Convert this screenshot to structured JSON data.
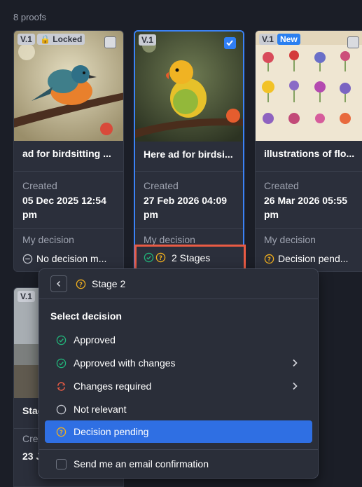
{
  "proof_count": "8 proofs",
  "colors": {
    "accent": "#2f6fe3",
    "approved": "#22b47a",
    "pending": "#f2b01e",
    "changes": "#ea5b44",
    "highlight": "#ea5b44"
  },
  "cards": [
    {
      "version": "V.1",
      "locked_label": "Locked",
      "checked": false,
      "title": "ad for birdsitting ...",
      "created_label": "Created",
      "created": "05 Dec 2025 12:54 pm",
      "decision_label": "My decision",
      "decision": "No decision m...",
      "decision_icon": "no-decision-icon"
    },
    {
      "version": "V.1",
      "checked": true,
      "title": "Here ad for birdsi...",
      "created_label": "Created",
      "created": "27 Feb 2026 04:09 pm",
      "decision_label": "My decision",
      "decision": "2 Stages",
      "decision_icon": "approved-pending-icons"
    },
    {
      "version": "V.1",
      "new_label": "New",
      "checked": false,
      "title": "illustrations of flo...",
      "created_label": "Created",
      "created": "26 Mar 2026 05:55 pm",
      "decision_label": "My decision",
      "decision": "Decision pend...",
      "decision_icon": "pending-icon"
    },
    {
      "version": "V.1",
      "title_partial": "Stag",
      "created_partial": "Cre",
      "date_partial": "23 J"
    }
  ],
  "popover": {
    "stage_title": "Stage 2",
    "back_icon": "chevron-left-icon",
    "section_title": "Select decision",
    "options": [
      {
        "label": "Approved",
        "icon": "check-circle-icon",
        "has_submenu": false,
        "active": false
      },
      {
        "label": "Approved with changes",
        "icon": "check-circle-icon",
        "has_submenu": true,
        "active": false
      },
      {
        "label": "Changes required",
        "icon": "changes-icon",
        "has_submenu": true,
        "active": false
      },
      {
        "label": "Not relevant",
        "icon": "empty-circle-icon",
        "has_submenu": false,
        "active": false
      },
      {
        "label": "Decision pending",
        "icon": "question-circle-icon",
        "has_submenu": false,
        "active": true
      }
    ],
    "email_label": "Send me an email confirmation"
  }
}
